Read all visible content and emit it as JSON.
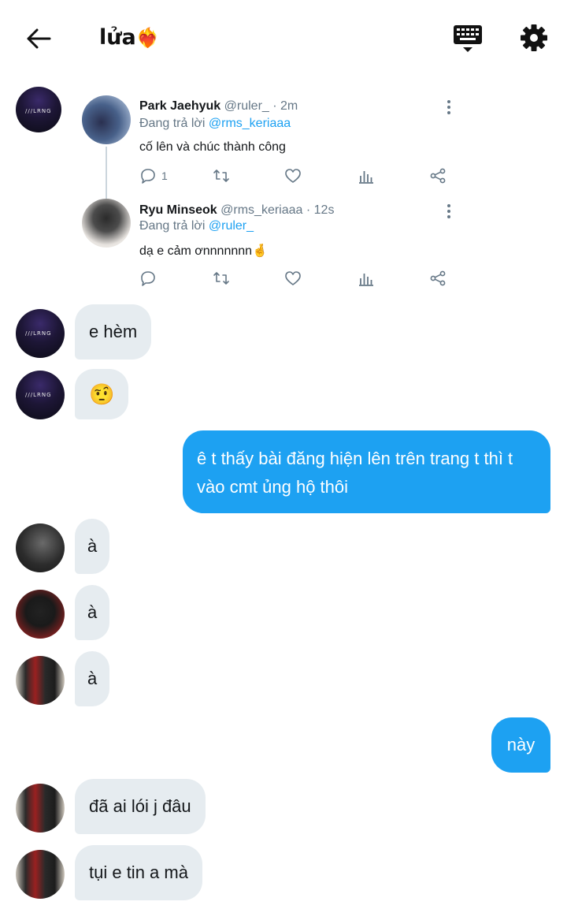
{
  "header": {
    "title": "lửa",
    "title_emoji": "❤️‍🔥"
  },
  "tweet_main": {
    "name": "Park Jaehyuk",
    "handle": "@ruler_",
    "time": "· 2m",
    "reply_prefix": "Đang trả lời",
    "reply_to": "@rms_keriaaa",
    "text": "cố lên và chúc thành công",
    "reply_count": "1"
  },
  "tweet_reply": {
    "name": "Ryu Minseok",
    "handle": "@rms_keriaaa",
    "time": "· 12s",
    "reply_prefix": "Đang trả lời",
    "reply_to": "@ruler_",
    "text": "dạ e cảm ơnnnnnnn",
    "text_emoji": "🤞"
  },
  "messages": [
    {
      "side": "left",
      "text": "e hèm"
    },
    {
      "side": "left",
      "emoji": "🤨"
    },
    {
      "side": "right",
      "text": "ê t thấy bài đăng hiện lên trên trang t thì t vào cmt ủng hộ thôi"
    },
    {
      "side": "left",
      "text": "à"
    },
    {
      "side": "left",
      "text": "à"
    },
    {
      "side": "left",
      "text": "à"
    },
    {
      "side": "right",
      "text": "này"
    },
    {
      "side": "left",
      "text": "đã ai lói j đâu"
    },
    {
      "side": "left",
      "text": "tụi e tin a mà"
    }
  ],
  "avatar_label": "///LRNG",
  "colors": {
    "accent": "#1da1f2",
    "bubble_left": "#e6ecf0",
    "muted": "#657786"
  }
}
